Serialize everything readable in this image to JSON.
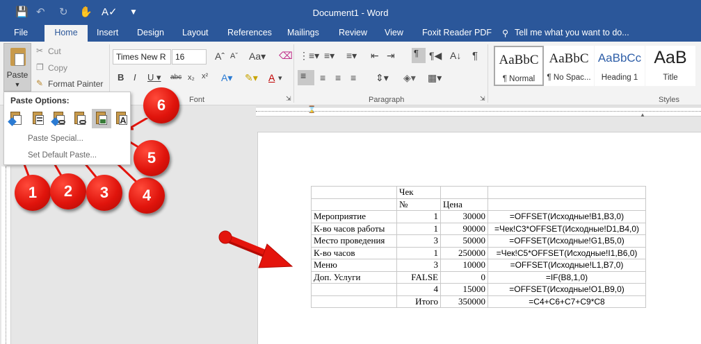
{
  "app": {
    "title": "Document1 - Word"
  },
  "tabs": [
    "File",
    "Home",
    "Insert",
    "Design",
    "Layout",
    "References",
    "Mailings",
    "Review",
    "View",
    "Foxit Reader PDF"
  ],
  "tell_me": "Tell me what you want to do...",
  "clipboard": {
    "paste": "Paste",
    "cut": "Cut",
    "copy": "Copy",
    "format_painter": "Format Painter"
  },
  "font": {
    "name": "Times New R",
    "size": "16",
    "group_label": "Font"
  },
  "paragraph": {
    "group_label": "Paragraph"
  },
  "styles": {
    "group_label": "Styles",
    "items": [
      {
        "sample": "AaBbC",
        "name": "¶ Normal"
      },
      {
        "sample": "AaBbC",
        "name": "¶ No Spac..."
      },
      {
        "sample": "AaBbCc",
        "name": "Heading 1"
      },
      {
        "sample": "AaB",
        "name": "Title"
      }
    ]
  },
  "paste_options": {
    "title": "Paste Options:",
    "menu": [
      "Paste Special...",
      "Set Default Paste..."
    ]
  },
  "markers": [
    "1",
    "2",
    "3",
    "4",
    "5",
    "6"
  ],
  "table": {
    "rows": [
      [
        "",
        "Чек",
        "",
        ""
      ],
      [
        "",
        "№",
        "Цена",
        ""
      ],
      [
        "Мероприятие",
        "1",
        "30000",
        "=OFFSET(Исходные!B1,B3,0)"
      ],
      [
        "К-во часов работы",
        "1",
        "90000",
        "=Чек!C3*OFFSET(Исходные!D1,B4,0)"
      ],
      [
        "Место проведения",
        "3",
        "50000",
        "=OFFSET(Исходные!G1,B5,0)"
      ],
      [
        "К-во часов",
        "1",
        "250000",
        "=Чек!C5*OFFSET(Исходные!I1,B6,0)"
      ],
      [
        "Меню",
        "3",
        "10000",
        "=OFFSET(Исходные!L1,B7,0)"
      ],
      [
        "Доп. Услуги",
        "FALSE",
        "0",
        "=IF(B8,1,0)"
      ],
      [
        "",
        "4",
        "15000",
        "=OFFSET(Исходные!O1,B9,0)"
      ],
      [
        "",
        "Итого",
        "350000",
        "=C4+C6+C7+C9*C8"
      ]
    ]
  },
  "colors": {
    "accent": "#2b579a",
    "marker": "#e0140c"
  }
}
